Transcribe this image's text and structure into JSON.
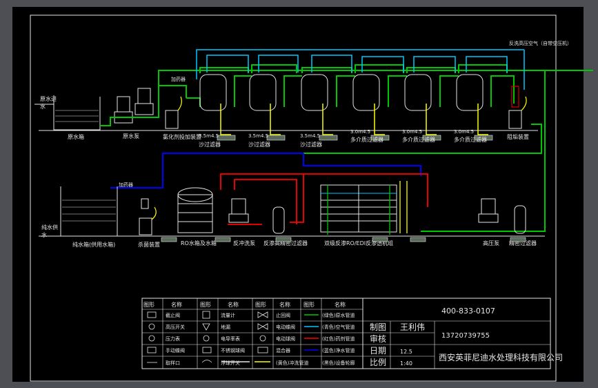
{
  "colors": {
    "background": "#000000",
    "frame": "#4d4f55",
    "raw_water": "#00c800",
    "air": "#00c8ff",
    "chemical": "#ff0000",
    "clean_water": "#0000ff",
    "flushing": "#ffff00",
    "equipment": "#e6e6e6"
  },
  "labels": {
    "raw_water_in_top": "原水进",
    "raw_water_in_top2": "水",
    "raw_tank": "原水箱",
    "raw_pump": "原水泵",
    "chlorine_dose": "氯化剂投加装置",
    "dosing_top": "加药器",
    "sand_filter_1": "沙过滤器",
    "sand_filter_2": "沙过滤器",
    "sand_filter_3": "沙过滤器",
    "multi_filter_1": "多介质过滤器",
    "multi_filter_2": "多介质过滤器",
    "multi_filter_3": "多介质过滤器",
    "softener": "阻垢装置",
    "spec_1": "3.5m4.5",
    "spec_2": "3.5m4.5",
    "spec_3": "3.5m4.5",
    "spec_4": "3.0m4.5",
    "spec_5": "3.0m4.5",
    "spec_6": "3.0m4.5",
    "backwash_note": "反洗高压空气（自带空压机）",
    "clean_tank": "纯水箱(供用水箱)",
    "clean_water_out": "纯水供",
    "clean_water_out2": "水",
    "dosing_mid": "加药器",
    "acid_device": "杀菌装置",
    "ro_tank": "RO水箱及水箱",
    "backflush_pump": "反冲洗泵",
    "hp_precision": "反渗高精密过滤器",
    "ro_unit": "双级反渗RO/EDI反渗透机组",
    "hp_pump": "高压泵",
    "precision_filter": "精密过滤器",
    "note_scale": "1:40"
  },
  "legend": {
    "headers": [
      "图形",
      "名称",
      "图形",
      "名称",
      "图形",
      "名称",
      "图形",
      "名称"
    ],
    "rows": [
      [
        "截止阀",
        "流量计",
        "止回阀",
        "(绿色)原水管道"
      ],
      [
        "高压开关",
        "地漏",
        "电动蝶阀",
        "(青色)空气管道"
      ],
      [
        "压力表",
        "电导率表",
        "电动球阀",
        "(红色)药剂管道"
      ],
      [
        "手动蝶阀",
        "不锈钢球阀",
        "混合器",
        "(蓝色)净水管道"
      ],
      [
        "取样口",
        "浮球开关",
        "(黄色)冲洗管道",
        "(黑色)设备轮廓"
      ]
    ]
  },
  "title_block": {
    "phone": "400-833-0107",
    "drawn_label": "制图",
    "drawn_name": "王利伟",
    "check_label": "审核",
    "mobile": "13720739755",
    "date_label": "日期",
    "date_value": "12.5",
    "scale_label": "比例",
    "scale_value": "1:40",
    "company": "西安英菲尼迪水处理科技有限公司"
  }
}
